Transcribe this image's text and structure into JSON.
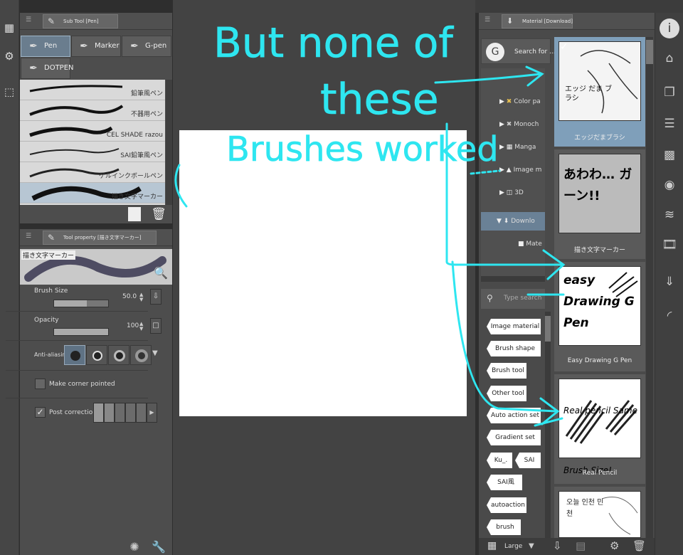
{
  "left_toolbar": {
    "icons": [
      "grid-icon",
      "gear-icon",
      "selection-icon"
    ]
  },
  "subtool": {
    "tab_label": "Sub Tool [Pen]",
    "buttons": [
      {
        "label": "Pen",
        "selected": true
      },
      {
        "label": "Marker"
      },
      {
        "label": "G-pen"
      },
      {
        "label": "DOTPEN"
      }
    ],
    "brushes": [
      "鉛筆風ペン",
      "不器用ペン",
      "CEL SHADE razou",
      "SAI鉛筆風ペン",
      "ゲルインクボールペン",
      "描き文字マーカー"
    ],
    "selected_brush_index": 5
  },
  "toolprop": {
    "tab_label": "Tool property [描き文字マーカー]",
    "preview_name": "描き文字マーカー",
    "brush_size_label": "Brush Size",
    "brush_size_value": "50.0",
    "brush_size_fill": 0.6,
    "opacity_label": "Opacity",
    "opacity_value": "100",
    "opacity_fill": 1.0,
    "antialias_label": "Anti-aliasing",
    "corner_label": "Make corner pointed",
    "post_label": "Post correction"
  },
  "material": {
    "tab_label": "Material [Download]",
    "search_placeholder": "Search for ...",
    "tree": [
      {
        "label": "Color pa",
        "icon": "color-pattern-icon"
      },
      {
        "label": "Monoch",
        "icon": "monochrome-icon"
      },
      {
        "label": "Manga",
        "icon": "manga-icon"
      },
      {
        "label": "Image m",
        "icon": "image-material-icon"
      },
      {
        "label": "3D",
        "icon": "cube-icon"
      },
      {
        "label": "Downlo",
        "icon": "download-icon",
        "selected": true
      },
      {
        "label": "Mate",
        "icon": "folder-icon"
      }
    ],
    "tag_search_placeholder": "Type search",
    "tags": [
      "Image material",
      "Brush shape",
      "Brush tool",
      "Other tool",
      "Auto action set",
      "Gradient set",
      "Ku_.",
      "SAI",
      "SAI風",
      "autoaction",
      "brush"
    ],
    "items": [
      {
        "name": "エッジだまブラシ",
        "selected": true,
        "thumb_text": "エッジ だま ブラシ"
      },
      {
        "name": "描き文字マーカー",
        "thumb_text": "あわわ… ガーン!!"
      },
      {
        "name": "Easy Drawing G Pen",
        "thumb_text": "easy Drawing G Pen"
      },
      {
        "name": "Real Pencil",
        "thumb_text": "Real pencil Same Brush Size!"
      },
      {
        "name": "",
        "thumb_text": "오늘 인천 민천"
      }
    ],
    "view_label": "Large"
  },
  "annotation": {
    "line1": "But none of",
    "line2": "these",
    "line3": "Brushes worked",
    "color": "#2ee6f0"
  }
}
